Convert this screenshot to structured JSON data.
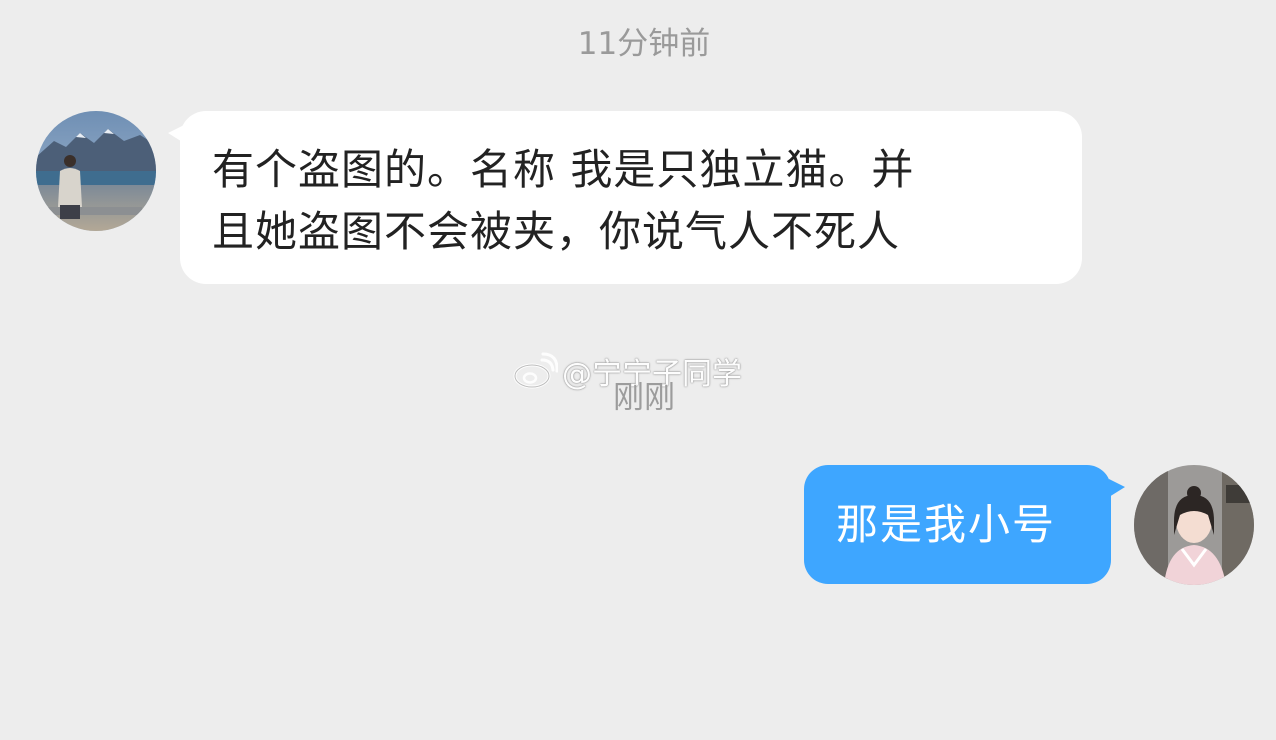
{
  "timestamps": {
    "top": "11分钟前",
    "middle": "刚刚"
  },
  "messages": [
    {
      "side": "left",
      "lines": [
        "有个盗图的。名称 我是只独立猫。并",
        "且她盗图不会被夹，你说气人不死人"
      ]
    },
    {
      "side": "right",
      "text": "那是我小号"
    }
  ],
  "watermark": {
    "text": "@宁宁子同学",
    "icon": "weibo-logo"
  },
  "colors": {
    "background": "#ededed",
    "incoming_bubble": "#ffffff",
    "outgoing_bubble": "#3ea6ff",
    "timestamp_text": "#9a9a9a"
  }
}
